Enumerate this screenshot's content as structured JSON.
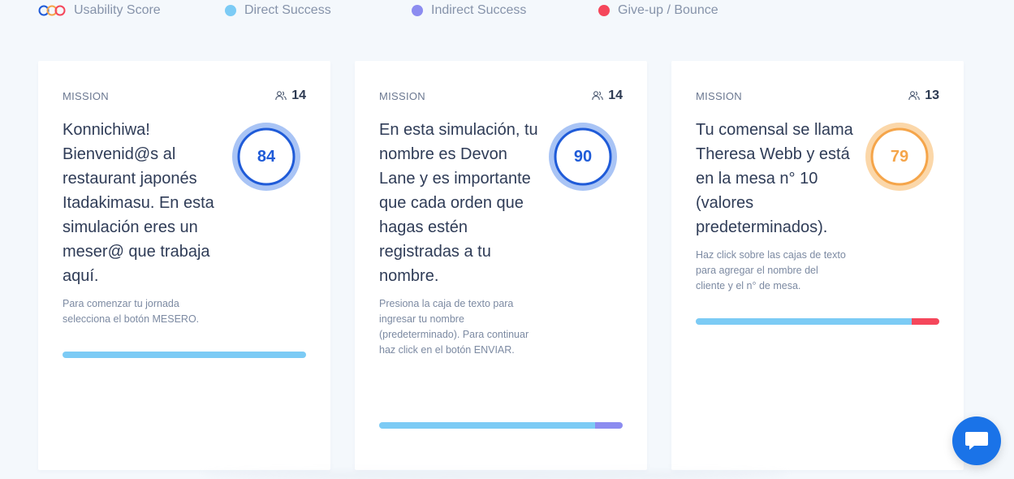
{
  "legend": {
    "usability": "Usability Score",
    "direct": "Direct Success",
    "indirect": "Indirect Success",
    "bounce": "Give-up / Bounce"
  },
  "colors": {
    "direct": "#7ccbf5",
    "indirect": "#8c8cf0",
    "bounce": "#f5475b",
    "score_blue": "#1f5bd8",
    "score_orange": "#f5a54a"
  },
  "missions": [
    {
      "label": "MISSION",
      "participants": "14",
      "title": "Konnichiwa! Bienvenid@s al restaurant japonés Itadakimasu. En esta simulación eres un meser@ que trabaja aquí.",
      "description": "Para comenzar tu jornada selecciona el botón MESERO.",
      "score": "84",
      "direct_pct": 100,
      "indirect_pct": 0,
      "bounce_pct": 0
    },
    {
      "label": "MISSION",
      "participants": "14",
      "title": "En esta simulación, tu nombre es Devon Lane y es importante que cada orden que hagas estén registradas a tu nombre.",
      "description": "Presiona la caja de texto para ingresar tu nombre (predeterminado). Para continuar haz click en el botón ENVIAR.",
      "score": "90",
      "direct_pct": 88.5,
      "indirect_pct": 11.5,
      "bounce_pct": 0
    },
    {
      "label": "MISSION",
      "participants": "13",
      "title": "Tu comensal se llama Theresa Webb y está en la mesa n° 10 (valores predeterminados).",
      "description": "Haz click sobre las cajas de texto para agregar el nombre del cliente y el n° de mesa.",
      "score": "79",
      "direct_pct": 88.5,
      "indirect_pct": 0,
      "bounce_pct": 11.5
    }
  ],
  "icons": {
    "participants": "users-icon",
    "chat": "chat-icon"
  }
}
